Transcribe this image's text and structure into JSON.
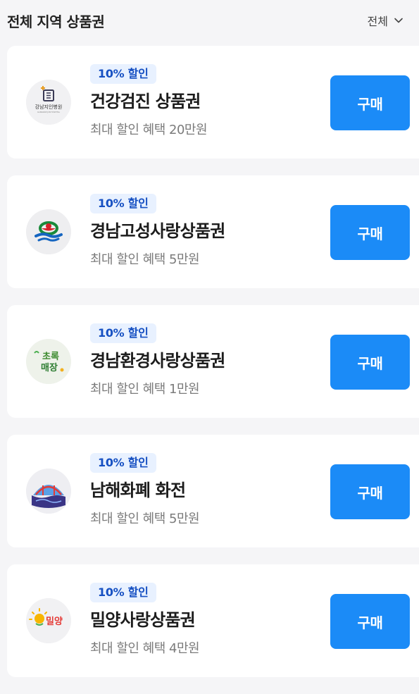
{
  "header": {
    "title": "전체 지역 상품권",
    "filter_label": "전체"
  },
  "vouchers": [
    {
      "badge": "10% 할인",
      "name": "건강검진 상품권",
      "benefit": "최대 할인 혜택 20만원",
      "buy_label": "구매",
      "logo_icon": "gangnam-hospital-logo",
      "logo_text": "강남지인병원",
      "logo_subtext": "GANGNAM JIIN HOSPITAL"
    },
    {
      "badge": "10% 할인",
      "name": "경남고성사랑상품권",
      "benefit": "최대 할인 혜택 5만원",
      "buy_label": "구매",
      "logo_icon": "goseong-emblem-logo"
    },
    {
      "badge": "10% 할인",
      "name": "경남환경사랑상품권",
      "benefit": "최대 할인 혜택 1만원",
      "buy_label": "구매",
      "logo_icon": "green-store-logo",
      "logo_text_top": "초록",
      "logo_text_bottom": "매장"
    },
    {
      "badge": "10% 할인",
      "name": "남해화폐 화전",
      "benefit": "최대 할인 혜택 5만원",
      "buy_label": "구매",
      "logo_icon": "namhae-bridge-logo"
    },
    {
      "badge": "10% 할인",
      "name": "밀양사랑상품권",
      "benefit": "최대 할인 혜택 4만원",
      "buy_label": "구매",
      "logo_icon": "miryang-sun-logo",
      "logo_text": "밀양"
    }
  ],
  "colors": {
    "accent": "#1b8bf7",
    "badge_bg": "#e8f1ff",
    "badge_text": "#1650c2",
    "page_bg": "#f5f5f7"
  }
}
